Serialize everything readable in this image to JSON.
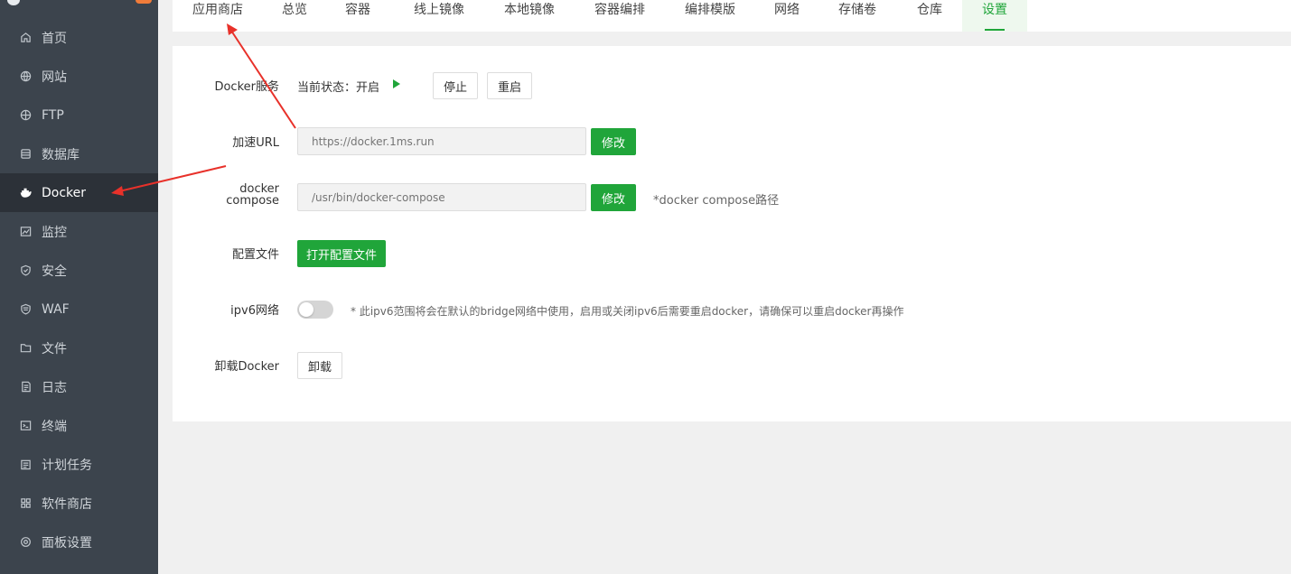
{
  "sidebar": {
    "items": [
      {
        "label": "首页",
        "icon": "home-icon"
      },
      {
        "label": "网站",
        "icon": "globe-icon"
      },
      {
        "label": "FTP",
        "icon": "globe-icon"
      },
      {
        "label": "数据库",
        "icon": "database-icon"
      },
      {
        "label": "Docker",
        "icon": "docker-icon"
      },
      {
        "label": "监控",
        "icon": "monitor-icon"
      },
      {
        "label": "安全",
        "icon": "shield-icon"
      },
      {
        "label": "WAF",
        "icon": "waf-shield-icon"
      },
      {
        "label": "文件",
        "icon": "folder-icon"
      },
      {
        "label": "日志",
        "icon": "log-icon"
      },
      {
        "label": "终端",
        "icon": "terminal-icon"
      },
      {
        "label": "计划任务",
        "icon": "calendar-icon"
      },
      {
        "label": "软件商店",
        "icon": "grid-icon"
      },
      {
        "label": "面板设置",
        "icon": "gear-icon"
      }
    ],
    "active": "Docker"
  },
  "tabs": [
    "应用商店",
    "总览",
    "容器",
    "线上镜像",
    "本地镜像",
    "容器编排",
    "编排模版",
    "网络",
    "存储卷",
    "仓库",
    "设置"
  ],
  "active_tab": "设置",
  "settings": {
    "service": {
      "label": "Docker服务",
      "status_text": "当前状态：开启",
      "stop_label": "停止",
      "restart_label": "重启"
    },
    "mirror": {
      "label": "加速URL",
      "placeholder": "https://docker.1ms.run",
      "button": "修改"
    },
    "compose": {
      "label_line1": "docker",
      "label_line2": "compose",
      "placeholder": "/usr/bin/docker-compose",
      "button": "修改",
      "hint": "*docker compose路径"
    },
    "config": {
      "label": "配置文件",
      "button": "打开配置文件"
    },
    "ipv6": {
      "label": "ipv6网络",
      "enabled": false,
      "hint": "* 此ipv6范围将会在默认的bridge网络中使用，启用或关闭ipv6后需要重启docker，请确保可以重启docker再操作"
    },
    "uninstall": {
      "label": "卸载Docker",
      "button": "卸载"
    }
  },
  "colors": {
    "accent": "#20a53a",
    "sidebar_bg": "#3c444d",
    "annotation_arrow": "#e8312a"
  }
}
